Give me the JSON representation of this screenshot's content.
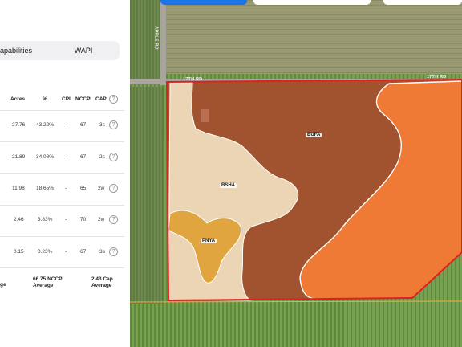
{
  "tabs": {
    "capabilities": "apabilities",
    "wapi": "WAPI"
  },
  "table": {
    "headers": {
      "acres": "Acres",
      "percent": "%",
      "cpi": "CPI",
      "nccpi": "NCCPI",
      "cap": "CAP"
    },
    "rows": [
      {
        "acres": "27.76",
        "percent": "43.22%",
        "cpi": "-",
        "nccpi": "67",
        "cap": "3s"
      },
      {
        "acres": "21.89",
        "percent": "34.08%",
        "cpi": "-",
        "nccpi": "67",
        "cap": "2s"
      },
      {
        "acres": "11.98",
        "percent": "18.65%",
        "cpi": "-",
        "nccpi": "65",
        "cap": "2w"
      },
      {
        "acres": "2.46",
        "percent": "3.83%",
        "cpi": "-",
        "nccpi": "70",
        "cap": "2w"
      },
      {
        "acres": "0.15",
        "percent": "0.23%",
        "cpi": "-",
        "nccpi": "67",
        "cap": "3s"
      }
    ],
    "summary": {
      "left": "ge",
      "nccpi_value": "66.75 NCCPI",
      "nccpi_sub": "Average",
      "cap_value": "2.43 Cap.",
      "cap_sub": "Average"
    }
  },
  "help_icon": "question-circle-icon",
  "map": {
    "soil_labels": {
      "bufa": "BUFA",
      "bsha": "BSHA",
      "pnya": "PNYA"
    },
    "road_labels": {
      "apple_rd": "APPLE RD",
      "r17th_left": "17TH RD",
      "r17th_right": "17TH RD"
    },
    "colors": {
      "bufa": "#a0532e",
      "orange": "#ee7a35",
      "bsha": "#ecd5b5",
      "pnya": "#e0a53e",
      "boundary": "#e02020",
      "accent_button": "#1a73e8"
    }
  }
}
